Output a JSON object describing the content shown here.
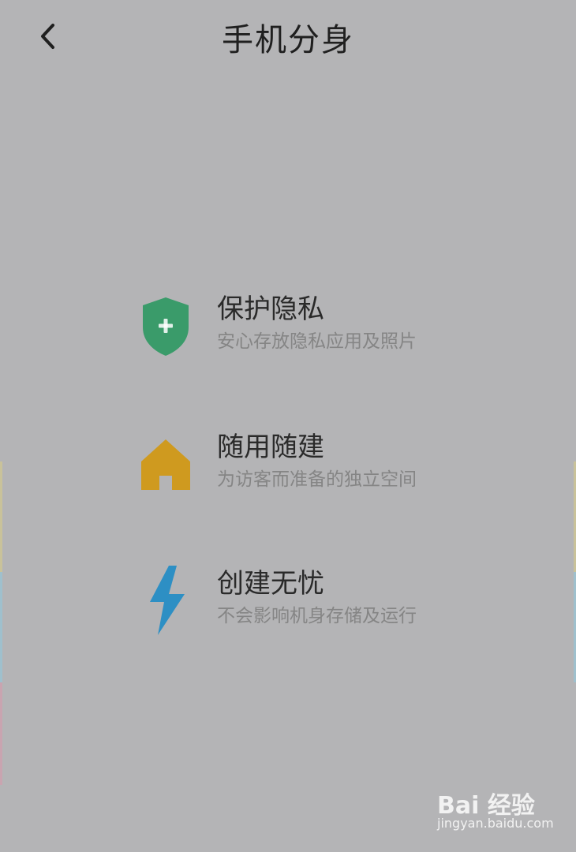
{
  "header": {
    "title": "手机分身",
    "back_icon": "chevron-left-icon"
  },
  "features": [
    {
      "icon": "shield-plus-icon",
      "icon_color": "#3a9b6a",
      "title": "保护隐私",
      "subtitle": "安心存放隐私应用及照片"
    },
    {
      "icon": "home-icon",
      "icon_color": "#cf9a1f",
      "title": "随用随建",
      "subtitle": "为访客而准备的独立空间"
    },
    {
      "icon": "lightning-icon",
      "icon_color": "#2d8fc4",
      "title": "创建无忧",
      "subtitle": "不会影响机身存储及运行"
    }
  ],
  "watermark": {
    "brand": "Bai 经验",
    "url": "jingyan.baidu.com"
  },
  "colors": {
    "background": "#b4b4b6"
  }
}
